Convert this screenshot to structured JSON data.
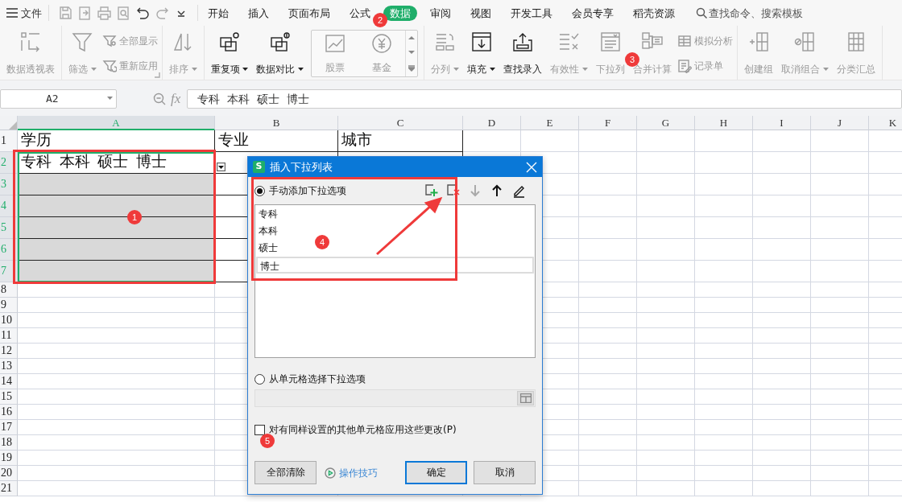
{
  "menu": {
    "file": "文件",
    "tabs": [
      {
        "label": "开始",
        "selected": false
      },
      {
        "label": "插入",
        "selected": false
      },
      {
        "label": "页面布局",
        "selected": false
      },
      {
        "label": "公式",
        "selected": false
      },
      {
        "label": "数据",
        "selected": true
      },
      {
        "label": "审阅",
        "selected": false
      },
      {
        "label": "视图",
        "selected": false
      },
      {
        "label": "开发工具",
        "selected": false
      },
      {
        "label": "会员专享",
        "selected": false
      },
      {
        "label": "稻壳资源",
        "selected": false
      }
    ],
    "search": "查找命令、搜索模板"
  },
  "ribbon": {
    "groups": [
      {
        "items": [
          {
            "kind": "large",
            "label": "数据透视表",
            "disabled": true,
            "menu": false
          }
        ]
      },
      {
        "launcher": true,
        "items": [
          {
            "kind": "large",
            "label": "筛选",
            "disabled": true,
            "menu": true
          },
          {
            "kind": "stack",
            "items": [
              {
                "label": "全部显示",
                "disabled": true
              },
              {
                "label": "重新应用",
                "disabled": true
              }
            ]
          }
        ]
      },
      {
        "items": [
          {
            "kind": "large",
            "label": "排序",
            "disabled": true,
            "menu": true
          }
        ]
      },
      {
        "items": [
          {
            "kind": "large",
            "label": "重复项",
            "disabled": false,
            "menu": true
          },
          {
            "kind": "large",
            "label": "数据对比",
            "disabled": false,
            "menu": true
          },
          {
            "kind": "gallery",
            "items": [
              {
                "label": "股票",
                "disabled": true
              },
              {
                "label": "基金",
                "disabled": true
              }
            ]
          }
        ]
      },
      {
        "items": [
          {
            "kind": "large",
            "label": "分列",
            "disabled": true,
            "menu": true
          },
          {
            "kind": "large",
            "label": "填充",
            "disabled": false,
            "menu": true
          },
          {
            "kind": "large",
            "label": "查找录入",
            "disabled": false,
            "menu": false
          },
          {
            "kind": "large",
            "label": "有效性",
            "disabled": true,
            "menu": true
          },
          {
            "kind": "large",
            "label": "下拉列",
            "disabled": true,
            "menu": false
          },
          {
            "kind": "large",
            "label": "合并计算",
            "disabled": true,
            "menu": false
          },
          {
            "kind": "stack",
            "items": [
              {
                "label": "模拟分析",
                "disabled": true
              },
              {
                "label": "记录单",
                "disabled": true
              }
            ]
          }
        ]
      },
      {
        "items": [
          {
            "kind": "large",
            "label": "创建组",
            "disabled": true,
            "menu": false
          },
          {
            "kind": "large",
            "label": "取消组合",
            "disabled": true,
            "menu": true
          },
          {
            "kind": "large",
            "label": "分类汇总",
            "disabled": true,
            "menu": false
          }
        ]
      }
    ]
  },
  "formula_bar": {
    "name_box": "A2",
    "fx": "fx",
    "formula": "专科  本科  硕士  博士"
  },
  "sheet": {
    "columns": [
      {
        "label": "A",
        "selected": true,
        "bordered": true
      },
      {
        "label": "B",
        "selected": false,
        "bordered": true
      },
      {
        "label": "C",
        "selected": false,
        "bordered": true
      },
      {
        "label": "D",
        "selected": false,
        "bordered": false
      },
      {
        "label": "E",
        "selected": false,
        "bordered": false
      },
      {
        "label": "F",
        "selected": false,
        "bordered": false
      },
      {
        "label": "G",
        "selected": false,
        "bordered": false
      },
      {
        "label": "H",
        "selected": false,
        "bordered": false
      },
      {
        "label": "I",
        "selected": false,
        "bordered": false
      },
      {
        "label": "J",
        "selected": false,
        "bordered": false
      },
      {
        "label": "K",
        "selected": false,
        "bordered": false
      }
    ],
    "rows": [
      {
        "label": "1",
        "selected": false,
        "bordered": true,
        "cells": [
          "学历",
          "专业",
          "城市"
        ]
      },
      {
        "label": "2",
        "selected": true,
        "active": true,
        "dropdown": true,
        "bordered": true,
        "cells": [
          "专科  本科  硕士  博士"
        ]
      },
      {
        "label": "3",
        "selected": true,
        "bordered": true
      },
      {
        "label": "4",
        "selected": true,
        "bordered": true
      },
      {
        "label": "5",
        "selected": true,
        "bordered": true
      },
      {
        "label": "6",
        "selected": true,
        "bordered": true
      },
      {
        "label": "7",
        "selected": true,
        "bordered": true
      },
      {
        "label": "8",
        "selected": false,
        "bordered": false
      },
      {
        "label": "9",
        "selected": false,
        "bordered": false
      },
      {
        "label": "10",
        "selected": false,
        "bordered": false
      },
      {
        "label": "11",
        "selected": false,
        "bordered": false
      },
      {
        "label": "12",
        "selected": false,
        "bordered": false
      },
      {
        "label": "13",
        "selected": false,
        "bordered": false
      },
      {
        "label": "14",
        "selected": false,
        "bordered": false
      },
      {
        "label": "15",
        "selected": false,
        "bordered": false
      },
      {
        "label": "16",
        "selected": false,
        "bordered": false
      },
      {
        "label": "17",
        "selected": false,
        "bordered": false
      },
      {
        "label": "18",
        "selected": false,
        "bordered": false
      },
      {
        "label": "19",
        "selected": false,
        "bordered": false
      },
      {
        "label": "20",
        "selected": false,
        "bordered": false
      },
      {
        "label": "21",
        "selected": false,
        "bordered": false
      }
    ]
  },
  "dialog": {
    "app_icon": "S",
    "title": "插入下拉列表",
    "options": [
      {
        "label": "手动添加下拉选项",
        "selected": true
      },
      {
        "label": "从单元格选择下拉选项",
        "selected": false
      }
    ],
    "tools": [
      {
        "disabled": false
      },
      {
        "disabled": false
      },
      {
        "disabled": true
      },
      {
        "disabled": false
      },
      {
        "disabled": false
      }
    ],
    "list_items": [
      {
        "text": "专科",
        "selected": false
      },
      {
        "text": "本科",
        "selected": false
      },
      {
        "text": "硕士",
        "selected": false
      },
      {
        "text": "博士",
        "selected": true
      }
    ],
    "checkbox": {
      "label": "对有同样设置的其他单元格应用这些更改(P)",
      "checked": false
    },
    "footer": [
      {
        "kind": "button",
        "label": "全部清除"
      },
      {
        "kind": "link",
        "label": "操作技巧"
      },
      {
        "kind": "primary",
        "label": "确定"
      },
      {
        "kind": "button",
        "label": "取消"
      }
    ]
  },
  "annotations": {
    "badges": [
      "1",
      "2",
      "3",
      "4",
      "5"
    ]
  }
}
